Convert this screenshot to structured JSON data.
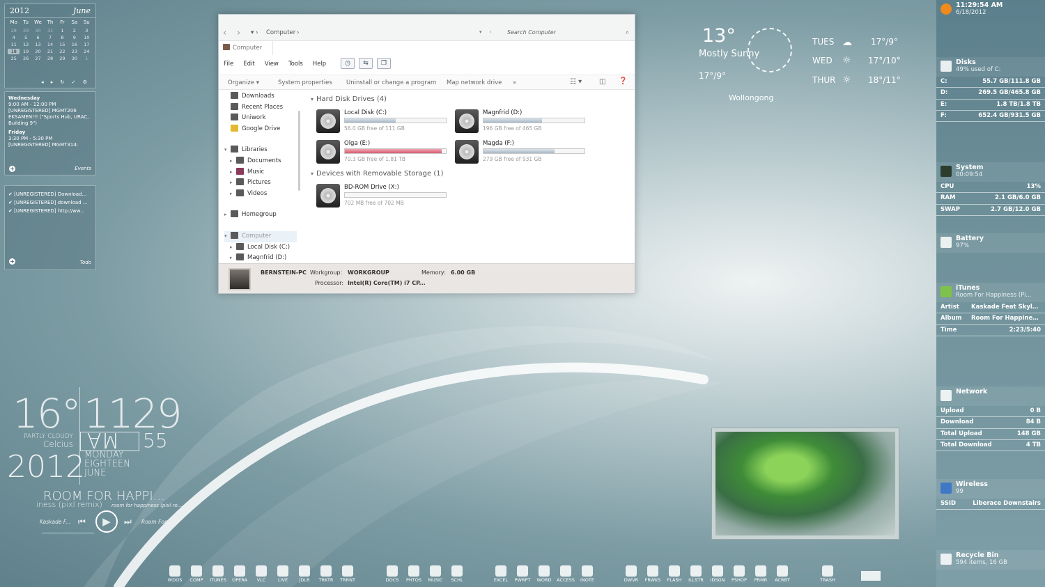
{
  "calendar": {
    "year": "2012",
    "month": "June",
    "weekdays": [
      "Mo",
      "Tu",
      "We",
      "Th",
      "Fr",
      "Sa",
      "Su"
    ],
    "days": [
      "28",
      "29",
      "30",
      "31",
      "1",
      "2",
      "3",
      "4",
      "5",
      "6",
      "7",
      "8",
      "9",
      "10",
      "11",
      "12",
      "13",
      "14",
      "15",
      "16",
      "17",
      "18",
      "19",
      "20",
      "21",
      "22",
      "23",
      "24",
      "25",
      "26",
      "27",
      "28",
      "29",
      "30",
      "1"
    ]
  },
  "events": {
    "items": [
      {
        "day": "Wednesday",
        "time": "9:00 AM - 12:00 PM",
        "title": "[UNREGISTERED] MGMT206 EKSAMEN!!! (\"Sports Hub, URAC, Building 9\")"
      },
      {
        "day": "Friday",
        "time": "3:30 PM - 5:30 PM",
        "title": "[UNREGISTERED] MGMT314:"
      }
    ],
    "footer": "Events"
  },
  "todo": {
    "items": [
      "[UNREGISTERED] Download...",
      "[UNREGISTERED] download ...",
      "[UNREGISTERED] http://ww..."
    ],
    "footer": "Todo"
  },
  "clock": {
    "temp": "16°",
    "time": "1129",
    "condition": "PARTLY CLOUDY",
    "unit": "Celcius",
    "ampm": "AM",
    "seconds": "55",
    "year": "2012",
    "weekday": "MONDAY",
    "day": "EIGHTEEN",
    "month": "JUNE"
  },
  "music": {
    "title": "ROOM FOR HAPPI...",
    "subtitle": "iness (pixl remix)",
    "line2": "room for happiness (pixl re...",
    "artist": "Kaskade F...",
    "album": "Room For..."
  },
  "explorer": {
    "back_icon": "‹",
    "fwd_icon": "›",
    "crumb": "Computer",
    "search_placeholder": "Search Computer",
    "tab": "Computer",
    "menu": [
      "File",
      "Edit",
      "View",
      "Tools",
      "Help"
    ],
    "cmd": [
      "Organize ▾",
      "System properties",
      "Uninstall or change a program",
      "Map network drive",
      "»"
    ],
    "nav": [
      "Downloads",
      "Recent Places",
      "Uniwork",
      "Google Drive",
      "Libraries",
      "Documents",
      "Music",
      "Pictures",
      "Videos",
      "Homegroup",
      "Computer",
      "Local Disk (C:)",
      "Magnfrid (D:)"
    ],
    "group1": "Hard Disk Drives (4)",
    "group2": "Devices with Removable Storage (1)",
    "drives": [
      {
        "name": "Local Disk (C:)",
        "free": "56.0 GB free of 111 GB",
        "used": 0.5,
        "color": "normal"
      },
      {
        "name": "Magnfrid (D:)",
        "free": "196 GB free of 465 GB",
        "used": 0.58,
        "color": "normal"
      },
      {
        "name": "Olga (E:)",
        "free": "70.3 GB free of 1.81 TB",
        "used": 0.96,
        "color": "red"
      },
      {
        "name": "Magda (F:)",
        "free": "279 GB free of 931 GB",
        "used": 0.7,
        "color": "normal"
      }
    ],
    "removable": {
      "name": "BD-ROM Drive (X:)",
      "free": "702 MB free of 702 MB"
    },
    "details": {
      "pc": "BERNSTEIN-PC",
      "wg_label": "Workgroup:",
      "wg": "WORKGROUP",
      "mem_label": "Memory:",
      "mem": "6.00 GB",
      "proc_label": "Processor:",
      "proc": "Intel(R) Core(TM) i7 CP..."
    }
  },
  "weather": {
    "temp": "13°",
    "condition": "Mostly Sunny",
    "range": "17°/9°",
    "city": "Wollongong",
    "forecast": [
      {
        "day": "TUES",
        "range": "17°/9°"
      },
      {
        "day": "WED",
        "range": "17°/10°"
      },
      {
        "day": "THUR",
        "range": "18°/11°"
      }
    ]
  },
  "sidebar": {
    "clock": {
      "time": "11:29:54 AM",
      "date": "6/18/2012"
    },
    "disks": {
      "title": "Disks",
      "sub": "49% used of C:",
      "rows": [
        [
          "C:",
          "55.7 GB/111.8 GB"
        ],
        [
          "D:",
          "269.5 GB/465.8 GB"
        ],
        [
          "E:",
          "1.8 TB/1.8 TB"
        ],
        [
          "F:",
          "652.4 GB/931.5 GB"
        ]
      ]
    },
    "system": {
      "title": "System",
      "sub": "00:09:54",
      "rows": [
        [
          "CPU",
          "13%"
        ],
        [
          "RAM",
          "2.1 GB/6.0 GB"
        ],
        [
          "SWAP",
          "2.7 GB/12.0 GB"
        ]
      ]
    },
    "battery": {
      "title": "Battery",
      "sub": "97%"
    },
    "itunes": {
      "title": "iTunes",
      "sub": "Room For Happiness (Pi...",
      "rows": [
        [
          "Artist",
          "Kaskade Feat Skylar G..."
        ],
        [
          "Album",
          "Room For Happiness..."
        ],
        [
          "Time",
          "2:23/5:40"
        ]
      ]
    },
    "network": {
      "title": "Network",
      "rows": [
        [
          "Upload",
          "0 B"
        ],
        [
          "Download",
          "84 B"
        ],
        [
          "Total Upload",
          "148 GB"
        ],
        [
          "Total Download",
          "4 TB"
        ]
      ]
    },
    "wireless": {
      "title": "Wireless",
      "sub": "99",
      "rows": [
        [
          "SSID",
          "Liberace Downstairs"
        ]
      ]
    },
    "recycle": {
      "title": "Recycle Bin",
      "sub": "594 items, 16 GB"
    }
  },
  "dock": [
    "WDOS",
    "COMP",
    "ITUNES",
    "OPERA",
    "VLC",
    "LIVE",
    "JDLR",
    "TRKTR",
    "TRRNT",
    "DOCS",
    "PHTOS",
    "MUSIC",
    "SCHL",
    "EXCEL",
    "PWRPT",
    "WORD",
    "ACCESS",
    "INOTE",
    "DWVR",
    "FRWKS",
    "FLASH",
    "ILLSTR",
    "IDSGN",
    "PSHOP",
    "PRMR",
    "ACRBT",
    "TRASH"
  ]
}
